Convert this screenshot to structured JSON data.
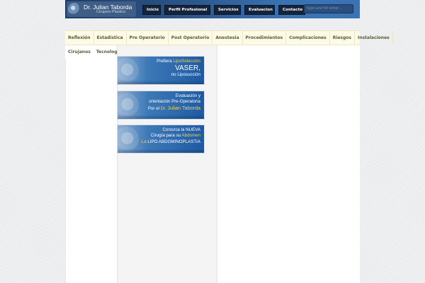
{
  "header": {
    "logo_name": "Dr. Julian Taborda",
    "logo_subtitle": "Cirujano Plastico",
    "nav": [
      "Inicio",
      "Perfil Profesional",
      "Servicios",
      "Evaluacion",
      "Contacto"
    ],
    "search_placeholder": "type and hit enter..."
  },
  "menu": {
    "items": [
      "Reflexión",
      "Estadística",
      "Pre Operatorio",
      "Post Operatorio",
      "Anestesia",
      "Procedimientos",
      "Complicaciones",
      "Riesgos",
      "Instalaciones"
    ],
    "subitems": [
      "Cirujanos",
      "Tecnología"
    ]
  },
  "banners": [
    {
      "line1_pre": "Prefiera ",
      "line1_hl": "LipoSelección",
      "line2": "VASER,",
      "line3": "no Liposucción"
    },
    {
      "line1": "Evaluación y",
      "line2": "orientación Pre-Operatoria",
      "line3_pre": "Por el ",
      "line3_hl1": "Dr. ",
      "line3_hl2": "Julian Taborda"
    },
    {
      "line1": "Conozca la NUEVA",
      "line2_pre": "Cirugía para su ",
      "line2_hl": "Abdomen",
      "line3_pre": "La ",
      "line3_hl": "LIPO ABDOMINOPLASTIA"
    }
  ],
  "colors": {
    "header_dark": "#1f3c67",
    "header_light": "#3a73b4",
    "nav_button": "#15243a",
    "menu_bg": "#fdfae5",
    "highlight": "#f5d04a"
  }
}
